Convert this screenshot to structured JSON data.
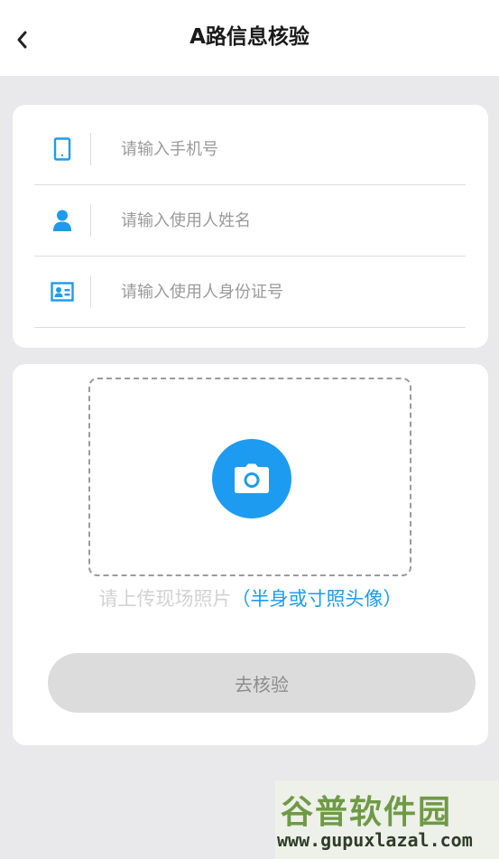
{
  "header": {
    "title": "A路信息核验",
    "back_icon": "chevron-left-icon"
  },
  "form": {
    "fields": [
      {
        "icon": "phone-icon",
        "placeholder": "请输入手机号",
        "value": ""
      },
      {
        "icon": "user-icon",
        "placeholder": "请输入使用人姓名",
        "value": ""
      },
      {
        "icon": "id-card-icon",
        "placeholder": "请输入使用人身份证号",
        "value": ""
      }
    ]
  },
  "upload": {
    "icon": "camera-icon",
    "hint_main": "请上传现场照片",
    "hint_detail": "（半身或寸照头像）"
  },
  "submit": {
    "label": "去核验"
  },
  "watermark": {
    "logo": "谷普软件园",
    "url": "www.gupuxlazal.com"
  },
  "colors": {
    "accent": "#1d9bf0",
    "background": "#e9e8ea",
    "button_disabled": "#dcdcdc"
  }
}
